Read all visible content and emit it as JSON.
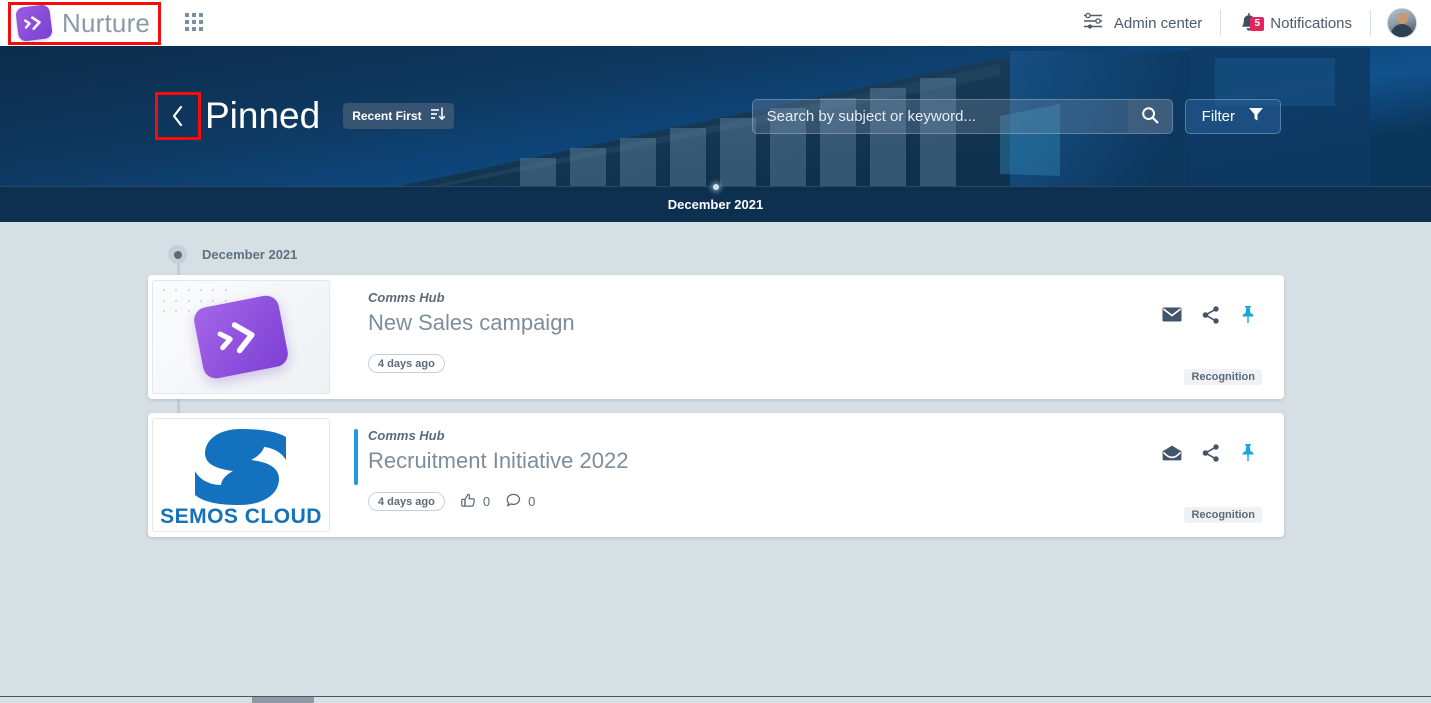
{
  "topbar": {
    "brand_name": "Nurture",
    "brand_icon": "nurture-chevrons-logo",
    "apps_icon": "app-grid-icon",
    "admin_center_label": "Admin center",
    "admin_center_icon": "sliders-icon",
    "notifications_label": "Notifications",
    "notifications_icon": "bell-icon",
    "notifications_badge": "5",
    "avatar_icon": "user-avatar"
  },
  "hero": {
    "back_icon": "chevron-left-icon",
    "title": "Pinned",
    "sort_label": "Recent First",
    "sort_icon": "sort-descending-icon",
    "search_placeholder": "Search by subject or keyword...",
    "search_value": "",
    "search_icon": "search-icon",
    "filter_label": "Filter",
    "filter_icon": "funnel-icon"
  },
  "month_band": {
    "label": "December 2021"
  },
  "timeline": {
    "group_label": "December 2021",
    "node_icon": "timeline-node-icon"
  },
  "cards": [
    {
      "thumbnail": "nurture-purple-logo-thumbnail",
      "source": "Comms Hub",
      "title": "New Sales campaign",
      "time_ago": "4 days ago",
      "has_counters": false,
      "likes": "",
      "comments": "",
      "accent": false,
      "mail_icon": "envelope-closed-icon",
      "share_icon": "share-icon",
      "pin_icon": "pin-icon",
      "tag": "Recognition"
    },
    {
      "thumbnail": "semos-cloud-logo-thumbnail",
      "thumbnail_text": "SEMOS CLOUD",
      "source": "Comms Hub",
      "title": "Recruitment Initiative 2022",
      "time_ago": "4 days ago",
      "has_counters": true,
      "likes": "0",
      "comments": "0",
      "accent": true,
      "mail_icon": "envelope-open-icon",
      "share_icon": "share-icon",
      "pin_icon": "pin-icon",
      "tag": "Recognition"
    }
  ],
  "colors": {
    "brand_purple": "#7c3fd4",
    "accent_blue": "#1f9bd8",
    "pin_blue": "#17a6e0",
    "badge_red": "#e0265c",
    "highlight_red": "#f50d0d",
    "page_bg": "#d6dfe4",
    "hero_dark": "#0d2f4f"
  }
}
